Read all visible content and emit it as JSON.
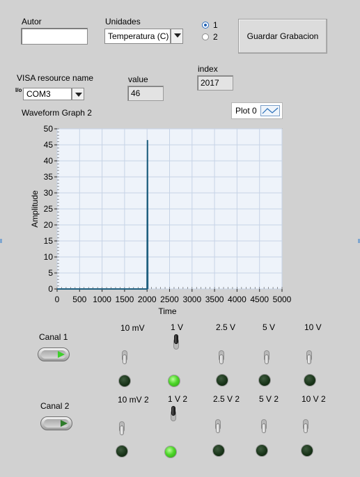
{
  "autor": {
    "label": "Autor",
    "value": ""
  },
  "unidades": {
    "label": "Unidades",
    "selected": "Temperatura (C)"
  },
  "radio": {
    "options": [
      "1",
      "2"
    ],
    "selected": "1"
  },
  "record_button": {
    "label": "Guardar Grabacion"
  },
  "visa": {
    "label": "VISA resource name",
    "value": "COM3",
    "prefix": "I/o"
  },
  "value_indicator": {
    "label": "value",
    "value": "46"
  },
  "index_indicator": {
    "label": "index",
    "value": "2017"
  },
  "graph": {
    "title": "Waveform Graph 2",
    "legend": "Plot 0"
  },
  "chart_data": {
    "type": "line",
    "title": "Waveform Graph 2",
    "xlabel": "Time",
    "ylabel": "Amplitude",
    "xlim": [
      0,
      5000
    ],
    "ylim": [
      0,
      50
    ],
    "x_ticks": [
      0,
      500,
      1000,
      1500,
      2000,
      2500,
      3000,
      3500,
      4000,
      4500,
      5000
    ],
    "y_ticks": [
      0,
      5,
      10,
      15,
      20,
      25,
      30,
      35,
      40,
      45,
      50
    ],
    "grid": true,
    "legend_position": "top-right",
    "series": [
      {
        "name": "Plot 0",
        "color": "#1f5f7f",
        "points": [
          [
            0,
            0
          ],
          [
            2000,
            0
          ],
          [
            2010,
            46.5
          ],
          [
            2016,
            0
          ],
          [
            2017,
            0
          ]
        ]
      }
    ]
  },
  "canal1": {
    "label": "Canal 1",
    "state": "on"
  },
  "canal2": {
    "label": "Canal 2",
    "state": "off"
  },
  "row1": [
    {
      "label": "10 mV",
      "switch": "down",
      "led": "off"
    },
    {
      "label": "1 V",
      "switch": "up",
      "led": "on"
    },
    {
      "label": "2.5 V",
      "switch": "down",
      "led": "off"
    },
    {
      "label": "5 V",
      "switch": "down",
      "led": "off"
    },
    {
      "label": "10 V",
      "switch": "down",
      "led": "off"
    }
  ],
  "row2": [
    {
      "label": "10 mV 2",
      "switch": "down",
      "led": "off"
    },
    {
      "label": "1 V 2",
      "switch": "up",
      "led": "on"
    },
    {
      "label": "2.5 V 2",
      "switch": "down",
      "led": "off"
    },
    {
      "label": "5 V 2",
      "switch": "down",
      "led": "off"
    },
    {
      "label": "10 V 2",
      "switch": "down",
      "led": "off"
    }
  ],
  "colors": {
    "panel": "#d1d1d1",
    "plot_bg": "#eef3fa",
    "grid": "#c6d3e6",
    "trace": "#1f5f7f",
    "led_on": "#4ed629"
  }
}
